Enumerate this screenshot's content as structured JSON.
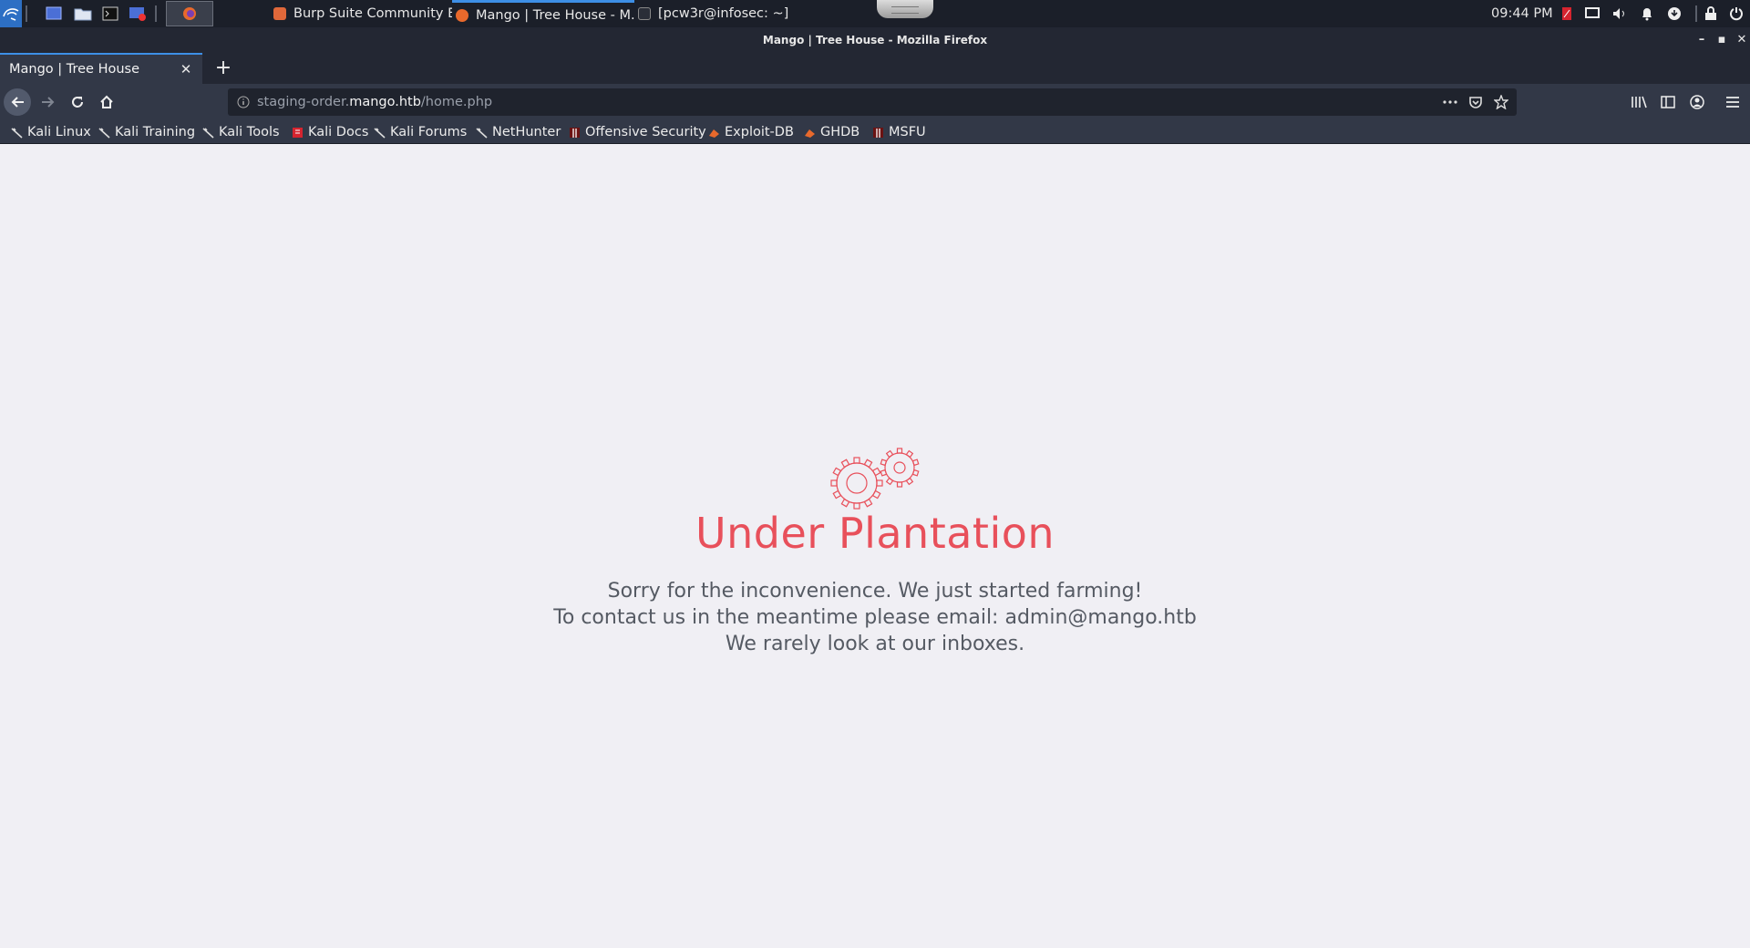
{
  "panel": {
    "tasks": [
      {
        "label": "Burp Suite Community E..."
      },
      {
        "label": "Mango | Tree House - M..."
      },
      {
        "label": "[pcw3r@infosec: ~]"
      }
    ],
    "clock": "09:44 PM"
  },
  "window": {
    "title": "Mango | Tree House - Mozilla Firefox",
    "tab_title": "Mango | Tree House"
  },
  "navbar": {
    "url_prefix": "staging-order.",
    "url_host": "mango.htb",
    "url_path": "/home.php"
  },
  "bookmarks": [
    {
      "label": "Kali Linux",
      "icon": "kali-dragon-icon"
    },
    {
      "label": "Kali Training",
      "icon": "kali-dragon-icon"
    },
    {
      "label": "Kali Tools",
      "icon": "kali-dragon-icon"
    },
    {
      "label": "Kali Docs",
      "icon": "kali-docs-icon"
    },
    {
      "label": "Kali Forums",
      "icon": "kali-dragon-icon"
    },
    {
      "label": "NetHunter",
      "icon": "kali-dragon-icon"
    },
    {
      "label": "Offensive Security",
      "icon": "offsec-icon"
    },
    {
      "label": "Exploit-DB",
      "icon": "exploit-db-icon"
    },
    {
      "label": "GHDB",
      "icon": "ghdb-icon"
    },
    {
      "label": "MSFU",
      "icon": "msfu-icon"
    }
  ],
  "page": {
    "heading": "Under Plantation",
    "line1": "Sorry for the inconvenience. We just started farming!",
    "line2": "To contact us in the meantime please email: admin@mango.htb",
    "line3": "We rarely look at our inboxes."
  },
  "colors": {
    "accent": "#e8505b",
    "tab_highlight": "#3d8fe6",
    "page_background": "#f0eff4"
  }
}
